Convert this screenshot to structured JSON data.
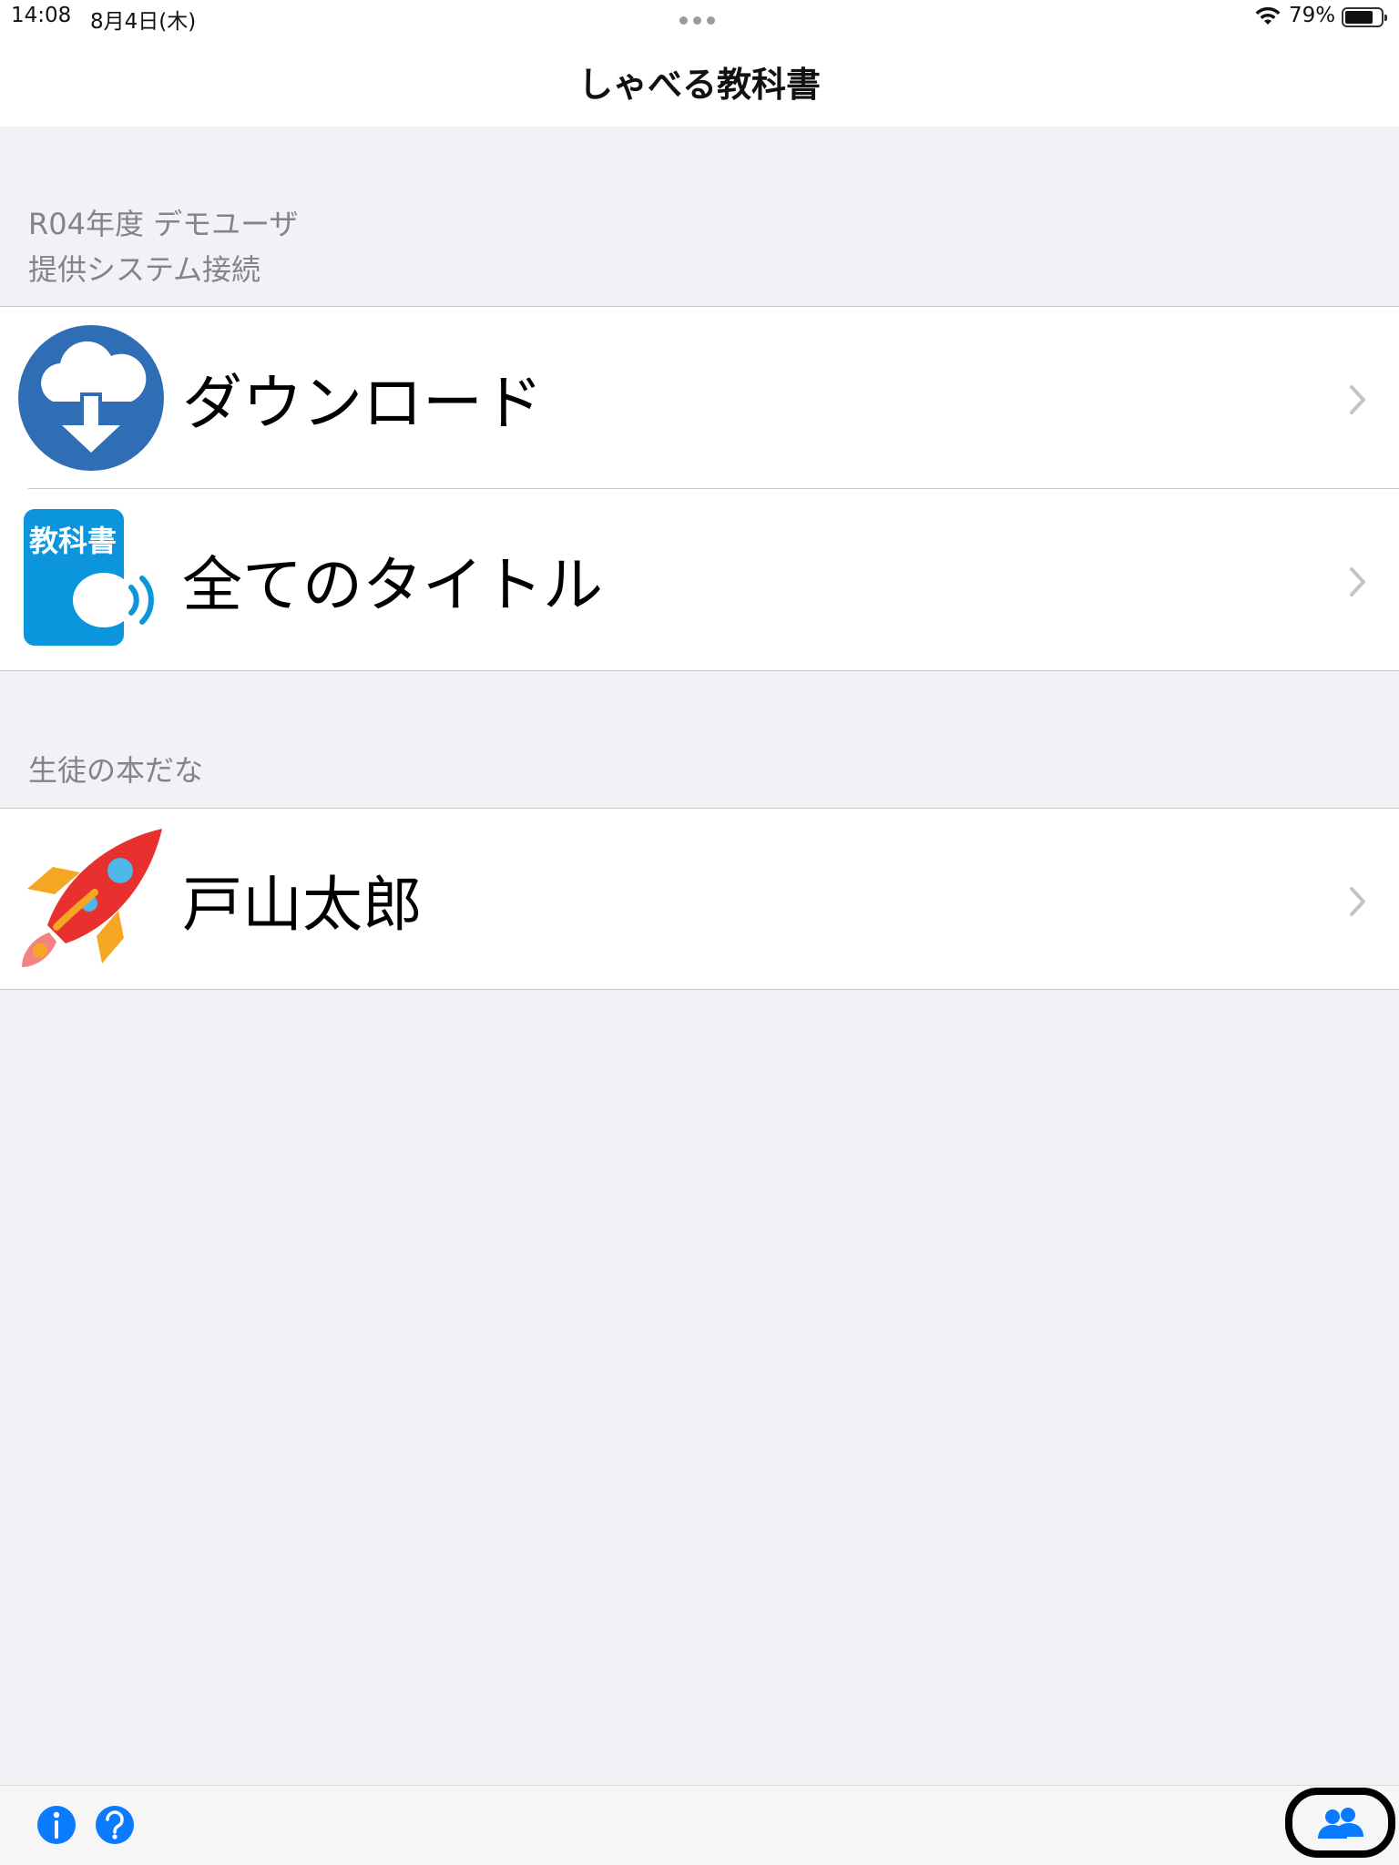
{
  "status_bar": {
    "time": "14:08",
    "date": "8月4日(木)",
    "battery_percent_label": "79%",
    "battery_level": 0.79
  },
  "nav": {
    "title": "しゃべる教科書"
  },
  "sections": [
    {
      "header_line1": "R04年度 デモユーザ",
      "header_line2": "提供システム接続",
      "rows": [
        {
          "label": "ダウンロード",
          "icon": "cloud-download-icon"
        },
        {
          "label": "全てのタイトル",
          "icon": "textbook-speaker-icon",
          "icon_text": "教科書"
        }
      ]
    },
    {
      "header_line1": "生徒の本だな",
      "rows": [
        {
          "label": "戸山太郎",
          "icon": "rocket-icon"
        }
      ]
    }
  ],
  "toolbar": {
    "left_icons": [
      "info-icon",
      "help-icon"
    ],
    "right_icon": "people-icon"
  },
  "colors": {
    "accent": "#0a7aff",
    "download_icon_bg": "#2f6db5",
    "textbook_icon_bg": "#0a95dc",
    "background": "#f1f1f6",
    "chevron": "#c4c4c7"
  }
}
